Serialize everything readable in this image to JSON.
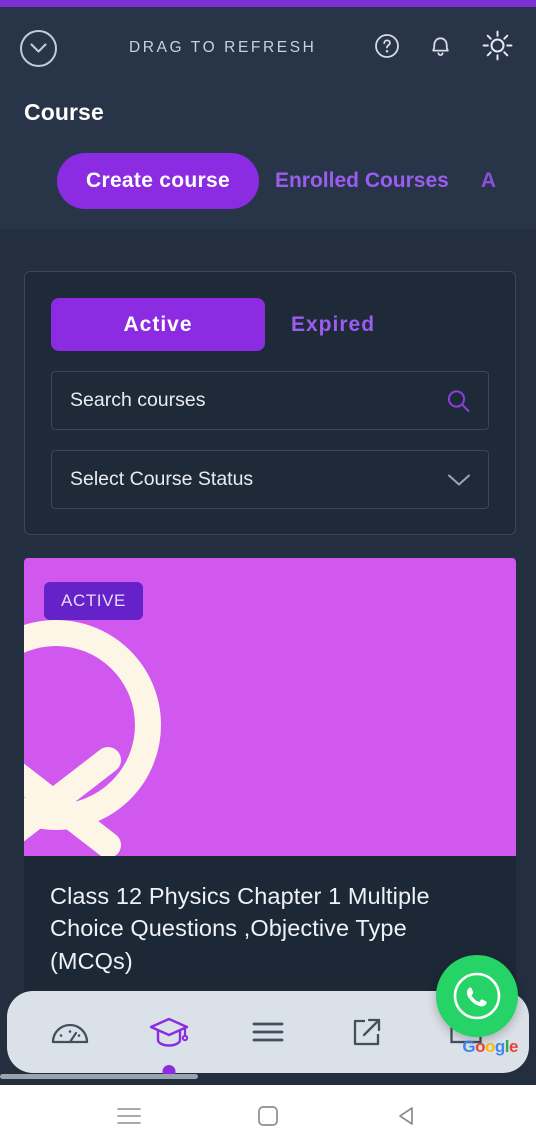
{
  "theme": {
    "accent": "#8b2be2",
    "accent_light": "#9b5cf0",
    "page_bg": "#232f3e",
    "header_bg": "#283447",
    "card_bg": "#1f2a38",
    "media_bg": "#d158ef",
    "badge_bg": "#6522c9",
    "whatsapp_green": "#25d366",
    "status_strip": "#7b2fd4"
  },
  "header": {
    "refresh_label": "DRAG TO REFRESH",
    "refresh_icon": "chevron-down-circle-icon",
    "page_title": "Course",
    "icons": [
      {
        "name": "help-icon",
        "glyph": "?"
      },
      {
        "name": "notifications-bell-icon",
        "glyph": "bell"
      },
      {
        "name": "theme-toggle-sun-icon",
        "glyph": "sun"
      }
    ],
    "tabs": [
      {
        "label": "Create course",
        "active": true
      },
      {
        "label": "Enrolled Courses",
        "active": false
      },
      {
        "label": "A",
        "active": false,
        "clipped": true
      }
    ]
  },
  "filters": {
    "segments": [
      {
        "label": "Active",
        "active": true
      },
      {
        "label": "Expired",
        "active": false
      }
    ],
    "search": {
      "placeholder": "Search courses",
      "value": "",
      "icon": "search-icon"
    },
    "status_select": {
      "value": "Select Course Status",
      "icon": "chevron-down-icon"
    }
  },
  "courses": [
    {
      "badge": "ACTIVE",
      "title": "Class 12 Physics Chapter 1 Multiple Choice Questions ,Objective Type (MCQs)",
      "media_logo": "letter-q-logo"
    }
  ],
  "bottom_nav": {
    "items": [
      {
        "name": "dashboard-gauge-icon",
        "active": false
      },
      {
        "name": "graduation-cap-icon",
        "active": true
      },
      {
        "name": "menu-hamburger-icon",
        "active": false
      },
      {
        "name": "external-link-icon",
        "active": false
      },
      {
        "name": "mail-envelope-icon",
        "active": false
      }
    ]
  },
  "google_widget": {
    "letters": [
      "G",
      "o",
      "o",
      "g",
      "l",
      "e"
    ]
  },
  "fab": {
    "name": "whatsapp-fab",
    "icon": "whatsapp-icon"
  },
  "system_nav": {
    "buttons": [
      {
        "name": "android-recents-button",
        "icon": "hamburger-icon"
      },
      {
        "name": "android-home-button",
        "icon": "square-icon"
      },
      {
        "name": "android-back-button",
        "icon": "triangle-left-icon"
      }
    ]
  }
}
